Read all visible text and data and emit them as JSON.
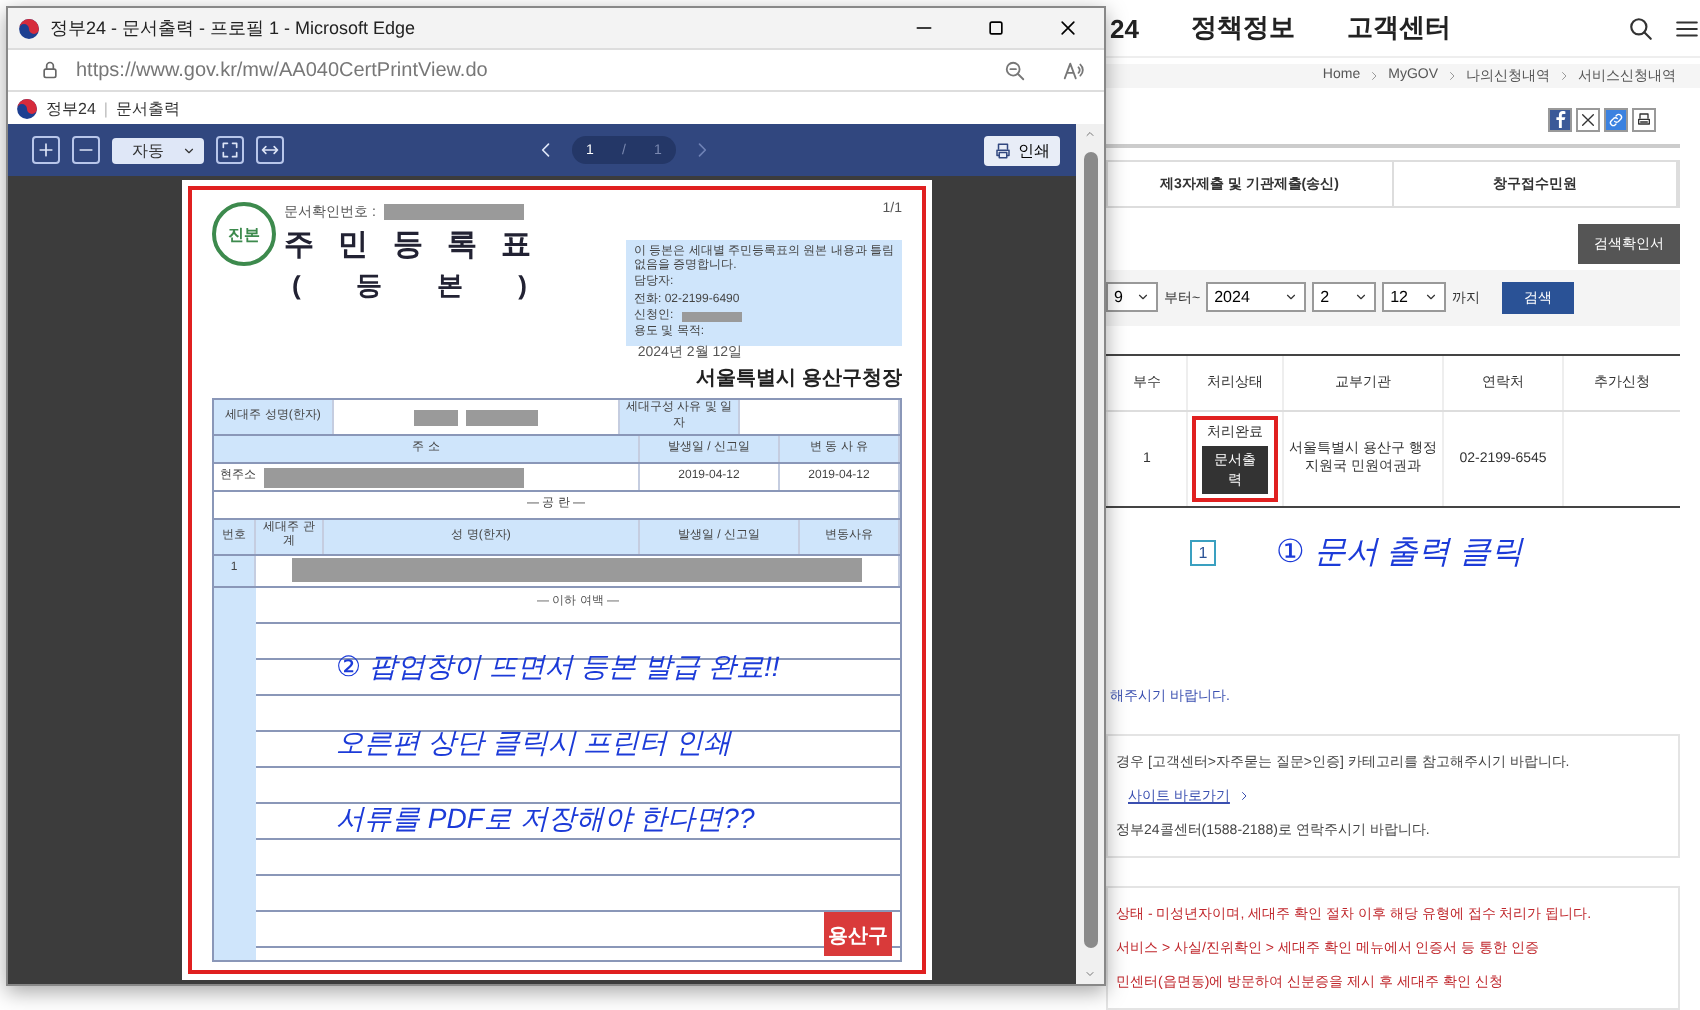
{
  "popup": {
    "title": "정부24 - 문서출력 - 프로필 1 - Microsoft Edge",
    "url": "https://www.gov.kr/mw/AA040CertPrintView.do",
    "site_brand": "정부24",
    "site_separator": "|",
    "site_page": "문서출력",
    "toolbar": {
      "zoom": "자동",
      "page_current": "1",
      "page_separator": "/",
      "page_total": "1",
      "print": "인쇄"
    },
    "document": {
      "confirm_label": "문서확인번호 :",
      "page_count": "1/1",
      "seal": "진본",
      "title": "주 민 등 록 표",
      "subtitle": "( 등 본 )",
      "notice": "이 등본은 세대별 주민등록표의 원본 내용과 틀림없음을 증명합니다.",
      "notice_fields": [
        "담당자:",
        "전화: 02-2199-6490",
        "신청인:",
        "용도 및 목적:"
      ],
      "date": "2024년 2월 12일",
      "issuer": "서울특별시 용산구청장",
      "head_labels": [
        "세대주 성명(한자)",
        "세대구성 사유 및 일자"
      ],
      "address_header": [
        "주 소",
        "발생일 / 신고일",
        "변 동 사 유"
      ],
      "address_row": {
        "label": "현주소",
        "occurred": "2019-04-12",
        "reported": "2019-04-12"
      },
      "blank_label": "— 공 란 —",
      "member_header": [
        "번호",
        "세대주 관계",
        "성 명(한자)",
        "발생일 / 신고일",
        "변동사유"
      ],
      "member_rows": [
        {
          "number": "1"
        }
      ],
      "end_label": "— 이하 여백 —",
      "annotations": [
        "② 팝업창이 뜨면서 등본 발급 완료!!",
        "오른편 상단 클릭시 프린터 인쇄",
        "서류를 PDF로 저장해야 한다면??"
      ],
      "district_stamp": "용산구"
    }
  },
  "site": {
    "nav": [
      "24",
      "정책정보",
      "고객센터"
    ],
    "breadcrumb": [
      "Home",
      "MyGOV",
      "나의신청내역",
      "서비스신청내역"
    ],
    "tabs": [
      {
        "label": "제3자제출 및 기관제출(송신)",
        "selected": false
      },
      {
        "label": "창구접수민원",
        "selected": false
      }
    ],
    "confirm_button": "검색확인서",
    "filter": {
      "from_value": "9",
      "from_suffix": "부터~",
      "year": "2024",
      "month": "2",
      "day": "12",
      "to_suffix": "까지",
      "search": "검색"
    },
    "table": {
      "columns": [
        "부수",
        "처리상태",
        "교부기관",
        "연락처",
        "추가신청"
      ],
      "rows": [
        {
          "copies": "1",
          "status": "처리완료",
          "action": "문서출력",
          "agency": "서울특별시 용산구 행정지원국 민원여권과",
          "contact": "02-2199-6545"
        }
      ]
    },
    "pagination": [
      {
        "label": "1",
        "selected": true
      }
    ],
    "annotation": "① 문서 출력 클릭",
    "notice_top": "해주시기 바랍니다.",
    "help_lines": [
      "경우 [고객센터>자주묻는 질문>인증] 카테고리를 참고해주시기 바랍니다.",
      "정부24콜센터(1588-2188)로 연락주시기 바랍니다."
    ],
    "help_link": "사이트 바로가기",
    "warning_lines": [
      "상태 - 미성년자이며, 세대주 확인 절차 이후 해당 유형에 접수 처리가 됩니다.",
      "서비스 > 사실/진위확인 > 세대주 확인 메뉴에서 인증서 등 통한 인증",
      "민센터(읍면동)에 방문하여 신분증을 제시 후 세대주 확인 신청"
    ]
  }
}
